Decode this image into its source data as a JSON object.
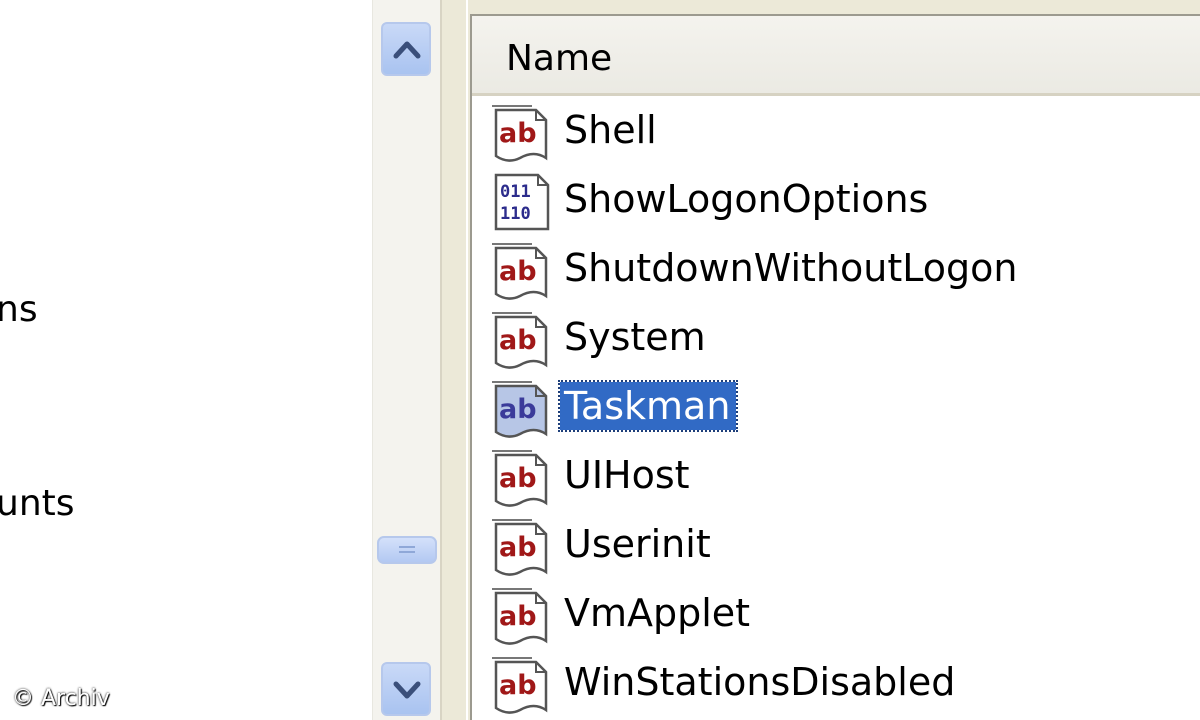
{
  "tree": {
    "items": [
      {
        "label": "ns"
      },
      {
        "label": "unts"
      }
    ]
  },
  "list": {
    "column_name": "Name",
    "selected_index": 4,
    "rows": [
      {
        "name": "Shell",
        "type_icon": "string-value-icon"
      },
      {
        "name": "ShowLogonOptions",
        "type_icon": "binary-value-icon"
      },
      {
        "name": "ShutdownWithoutLogon",
        "type_icon": "string-value-icon"
      },
      {
        "name": "System",
        "type_icon": "string-value-icon"
      },
      {
        "name": "Taskman",
        "type_icon": "string-value-icon"
      },
      {
        "name": "UIHost",
        "type_icon": "string-value-icon"
      },
      {
        "name": "Userinit",
        "type_icon": "string-value-icon"
      },
      {
        "name": "VmApplet",
        "type_icon": "string-value-icon"
      },
      {
        "name": "WinStationsDisabled",
        "type_icon": "string-value-icon"
      }
    ]
  },
  "scrollbar": {
    "up_icon": "chevron-up-icon",
    "down_icon": "chevron-down-icon"
  },
  "colors": {
    "selection": "#316ac5",
    "string_icon_red": "#a01818",
    "binary_icon_blue": "#2c2c8c"
  },
  "watermark": "© Archiv"
}
